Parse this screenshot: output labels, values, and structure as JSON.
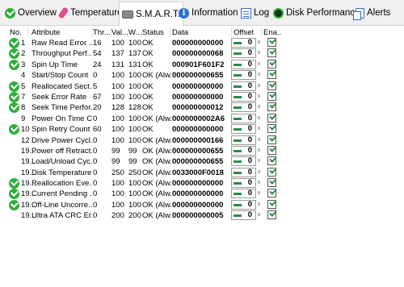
{
  "tabs": [
    {
      "label": "Overview",
      "icon": "check-circle-icon",
      "active": false
    },
    {
      "label": "Temperature",
      "icon": "thermometer-icon",
      "active": false
    },
    {
      "label": "S.M.A.R.T.",
      "icon": "disk-drive-icon",
      "active": true
    },
    {
      "label": "Information",
      "icon": "info-icon",
      "active": false
    },
    {
      "label": "Log",
      "icon": "log-icon",
      "active": false
    },
    {
      "label": "Disk Performance",
      "icon": "gauge-icon",
      "active": false
    },
    {
      "label": "Alerts",
      "icon": "alerts-icon",
      "active": false
    }
  ],
  "columns": {
    "no": "No.",
    "attribute": "Attribute",
    "threshold": "Thr...",
    "value": "Val...",
    "worst": "W...",
    "status": "Status",
    "data": "Data",
    "offset": "Offset",
    "enabled": "Ena..."
  },
  "rows": [
    {
      "ok": true,
      "no": "1",
      "attribute": "Raw Read Error ...",
      "thr": "16",
      "val": "100",
      "worst": "100",
      "status": "OK",
      "data": "000000000000",
      "offset": "0",
      "enabled": true
    },
    {
      "ok": true,
      "no": "2",
      "attribute": "Throughput Perf...",
      "thr": "54",
      "val": "137",
      "worst": "137",
      "status": "OK",
      "data": "000000000068",
      "offset": "0",
      "enabled": true
    },
    {
      "ok": true,
      "no": "3",
      "attribute": "Spin Up Time",
      "thr": "24",
      "val": "131",
      "worst": "131",
      "status": "OK",
      "data": "000901F601F2",
      "offset": "0",
      "enabled": true
    },
    {
      "ok": false,
      "no": "4",
      "attribute": "Start/Stop Count",
      "thr": "0",
      "val": "100",
      "worst": "100",
      "status": "OK (Alw...",
      "data": "000000000655",
      "offset": "0",
      "enabled": true
    },
    {
      "ok": true,
      "no": "5",
      "attribute": "Reallocated Sect...",
      "thr": "5",
      "val": "100",
      "worst": "100",
      "status": "OK",
      "data": "000000000000",
      "offset": "0",
      "enabled": true
    },
    {
      "ok": true,
      "no": "7",
      "attribute": "Seek Error Rate",
      "thr": "67",
      "val": "100",
      "worst": "100",
      "status": "OK",
      "data": "000000000000",
      "offset": "0",
      "enabled": true
    },
    {
      "ok": true,
      "no": "8",
      "attribute": "Seek Time Perfor...",
      "thr": "20",
      "val": "128",
      "worst": "128",
      "status": "OK",
      "data": "000000000012",
      "offset": "0",
      "enabled": true
    },
    {
      "ok": false,
      "no": "9",
      "attribute": "Power On Time C...",
      "thr": "0",
      "val": "100",
      "worst": "100",
      "status": "OK (Alw...",
      "data": "0000000002A6",
      "offset": "0",
      "enabled": true
    },
    {
      "ok": true,
      "no": "10",
      "attribute": "Spin Retry Count",
      "thr": "60",
      "val": "100",
      "worst": "100",
      "status": "OK",
      "data": "000000000000",
      "offset": "0",
      "enabled": true
    },
    {
      "ok": false,
      "no": "12",
      "attribute": "Drive Power Cycl...",
      "thr": "0",
      "val": "100",
      "worst": "100",
      "status": "OK (Alw...",
      "data": "000000000166",
      "offset": "0",
      "enabled": true
    },
    {
      "ok": false,
      "no": "19...",
      "attribute": "Power off Retract...",
      "thr": "0",
      "val": "99",
      "worst": "99",
      "status": "OK (Alw...",
      "data": "000000000655",
      "offset": "0",
      "enabled": true
    },
    {
      "ok": false,
      "no": "19...",
      "attribute": "Load/Unload Cyc...",
      "thr": "0",
      "val": "99",
      "worst": "99",
      "status": "OK (Alw...",
      "data": "000000000655",
      "offset": "0",
      "enabled": true
    },
    {
      "ok": false,
      "no": "19...",
      "attribute": "Disk Temperature",
      "thr": "0",
      "val": "250",
      "worst": "250",
      "status": "OK (Alw...",
      "data": "0033000F0018",
      "offset": "0",
      "enabled": true
    },
    {
      "ok": true,
      "no": "19...",
      "attribute": "Reallocation Eve...",
      "thr": "0",
      "val": "100",
      "worst": "100",
      "status": "OK (Alw...",
      "data": "000000000000",
      "offset": "0",
      "enabled": true
    },
    {
      "ok": true,
      "no": "19...",
      "attribute": "Current Pending ...",
      "thr": "0",
      "val": "100",
      "worst": "100",
      "status": "OK (Alw...",
      "data": "000000000000",
      "offset": "0",
      "enabled": true
    },
    {
      "ok": true,
      "no": "19...",
      "attribute": "Off-Line Uncorre...",
      "thr": "0",
      "val": "100",
      "worst": "100",
      "status": "OK (Alw...",
      "data": "000000000000",
      "offset": "0",
      "enabled": true
    },
    {
      "ok": false,
      "no": "19...",
      "attribute": "Ultra ATA CRC Er...",
      "thr": "0",
      "val": "200",
      "worst": "200",
      "status": "OK (Alw...",
      "data": "000000000005",
      "offset": "0",
      "enabled": true
    }
  ]
}
